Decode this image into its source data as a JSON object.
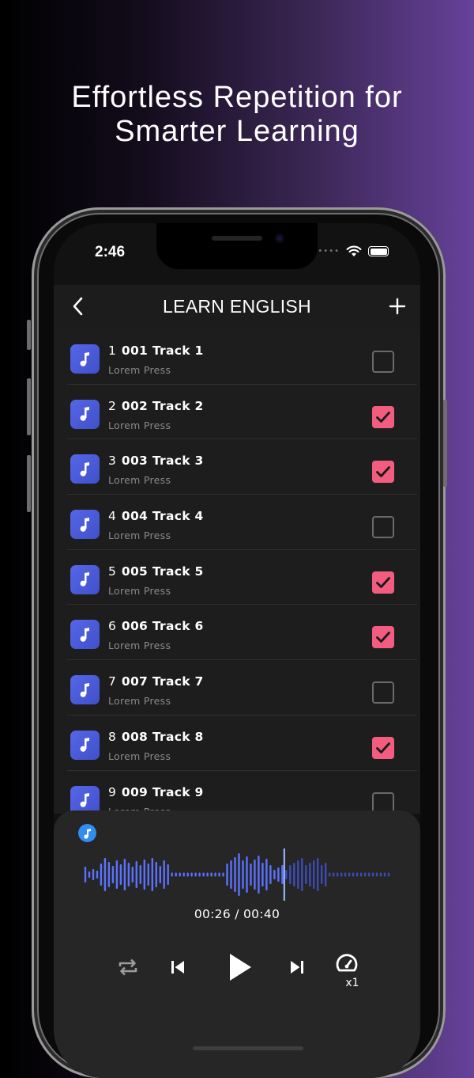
{
  "headline": {
    "line1": "Effortless Repetition for",
    "line2": "Smarter Learning"
  },
  "status_bar": {
    "time": "2:46"
  },
  "nav": {
    "title": "LEARN ENGLISH"
  },
  "tracks": [
    {
      "number": "1",
      "name": "001 Track 1",
      "subtitle": "Lorem Press",
      "checked": false
    },
    {
      "number": "2",
      "name": "002 Track 2",
      "subtitle": "Lorem Press",
      "checked": true
    },
    {
      "number": "3",
      "name": "003 Track 3",
      "subtitle": "Lorem Press",
      "checked": true
    },
    {
      "number": "4",
      "name": "004 Track 4",
      "subtitle": "Lorem Press",
      "checked": false
    },
    {
      "number": "5",
      "name": "005 Track 5",
      "subtitle": "Lorem Press",
      "checked": true
    },
    {
      "number": "6",
      "name": "006 Track 6",
      "subtitle": "Lorem Press",
      "checked": true
    },
    {
      "number": "7",
      "name": "007 Track 7",
      "subtitle": "Lorem Press",
      "checked": false
    },
    {
      "number": "8",
      "name": "008 Track 8",
      "subtitle": "Lorem Press",
      "checked": true
    },
    {
      "number": "9",
      "name": "009 Track 9",
      "subtitle": "Lorem Press",
      "checked": false
    }
  ],
  "player": {
    "time_display": "00:26 / 00:40",
    "progress_fraction": 0.65,
    "speed_label": "x1"
  },
  "colors": {
    "accent_check": "#f25c7e",
    "track_icon": "#4a5ad8",
    "wave_played": "#5b72ff",
    "wave_unplayed": "#3d4bb5",
    "playhead": "#9fc2ff"
  }
}
